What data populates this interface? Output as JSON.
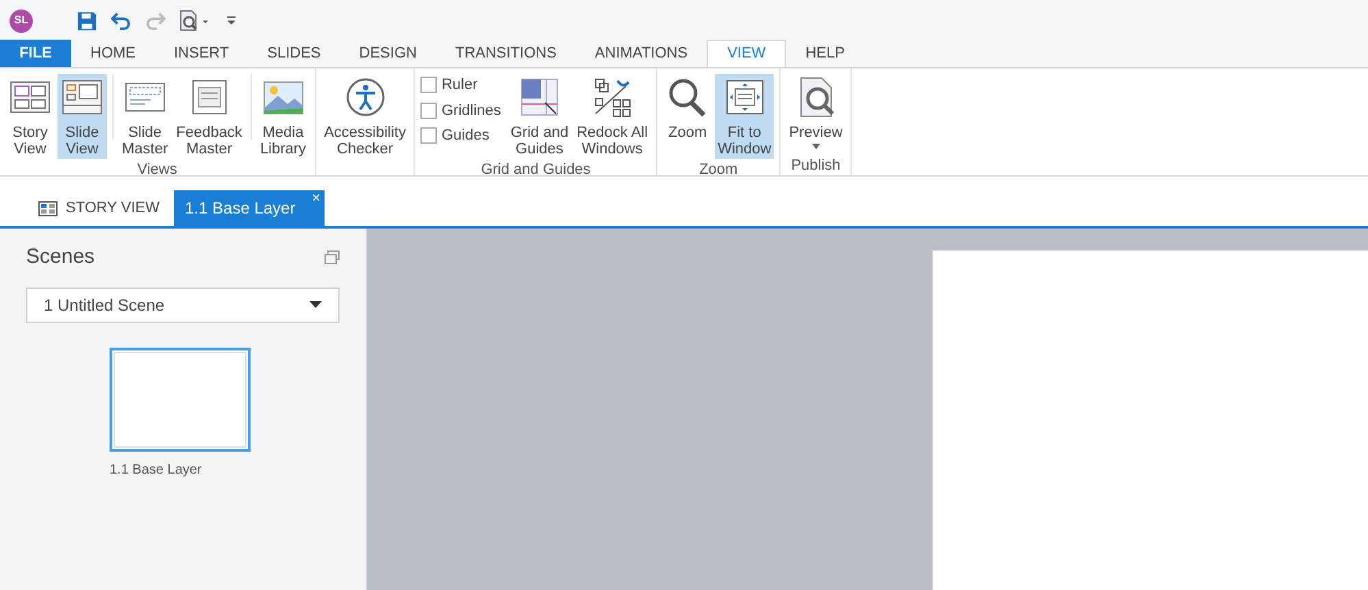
{
  "app_badge": "SL",
  "ribbon_tabs": [
    {
      "label": "FILE",
      "kind": "file"
    },
    {
      "label": "HOME",
      "kind": "tab",
      "selected": false
    },
    {
      "label": "INSERT",
      "kind": "tab",
      "selected": false
    },
    {
      "label": "SLIDES",
      "kind": "tab",
      "selected": false
    },
    {
      "label": "DESIGN",
      "kind": "tab",
      "selected": false
    },
    {
      "label": "TRANSITIONS",
      "kind": "tab",
      "selected": false
    },
    {
      "label": "ANIMATIONS",
      "kind": "tab",
      "selected": false
    },
    {
      "label": "VIEW",
      "kind": "tab",
      "selected": true
    },
    {
      "label": "HELP",
      "kind": "tab",
      "selected": false
    }
  ],
  "ribbon_groups": [
    {
      "label": "Views",
      "items": [
        {
          "kind": "button",
          "label": "Story\nView",
          "selected": false
        },
        {
          "kind": "button",
          "label": "Slide\nView",
          "selected": true
        },
        {
          "kind": "divider"
        },
        {
          "kind": "button",
          "label": "Slide\nMaster",
          "selected": false
        },
        {
          "kind": "button",
          "label": "Feedback\nMaster",
          "selected": false
        },
        {
          "kind": "divider"
        },
        {
          "kind": "button",
          "label": "Media\nLibrary",
          "selected": false
        }
      ]
    },
    {
      "items": [
        {
          "kind": "button",
          "label": "Accessibility\nChecker",
          "selected": false
        }
      ]
    },
    {
      "label": "Grid and Guides",
      "items": [
        {
          "kind": "checks",
          "options": [
            {
              "label": "Ruler",
              "checked": false
            },
            {
              "label": "Gridlines",
              "checked": false
            },
            {
              "label": "Guides",
              "checked": false
            }
          ]
        },
        {
          "kind": "button",
          "label": "Grid and\nGuides",
          "selected": false
        },
        {
          "kind": "button",
          "label": "Redock All\nWindows",
          "selected": false
        }
      ]
    },
    {
      "label": "Zoom",
      "items": [
        {
          "kind": "button",
          "label": "Zoom",
          "selected": false
        },
        {
          "kind": "button",
          "label": "Fit to\nWindow",
          "selected": true
        }
      ]
    },
    {
      "label": "Publish",
      "items": [
        {
          "kind": "button",
          "label": "Preview",
          "selected": false,
          "dropdown": true
        }
      ]
    }
  ],
  "doc_tabs": [
    {
      "label": "STORY VIEW",
      "selected": false,
      "closable": false
    },
    {
      "label": "1.1 Base Layer",
      "selected": true,
      "closable": true
    }
  ],
  "close_glyph": "×",
  "scenes": {
    "title": "Scenes",
    "dropdown_value": "1 Untitled Scene",
    "slides": [
      {
        "label": "1.1 Base Layer",
        "selected": true
      }
    ]
  }
}
